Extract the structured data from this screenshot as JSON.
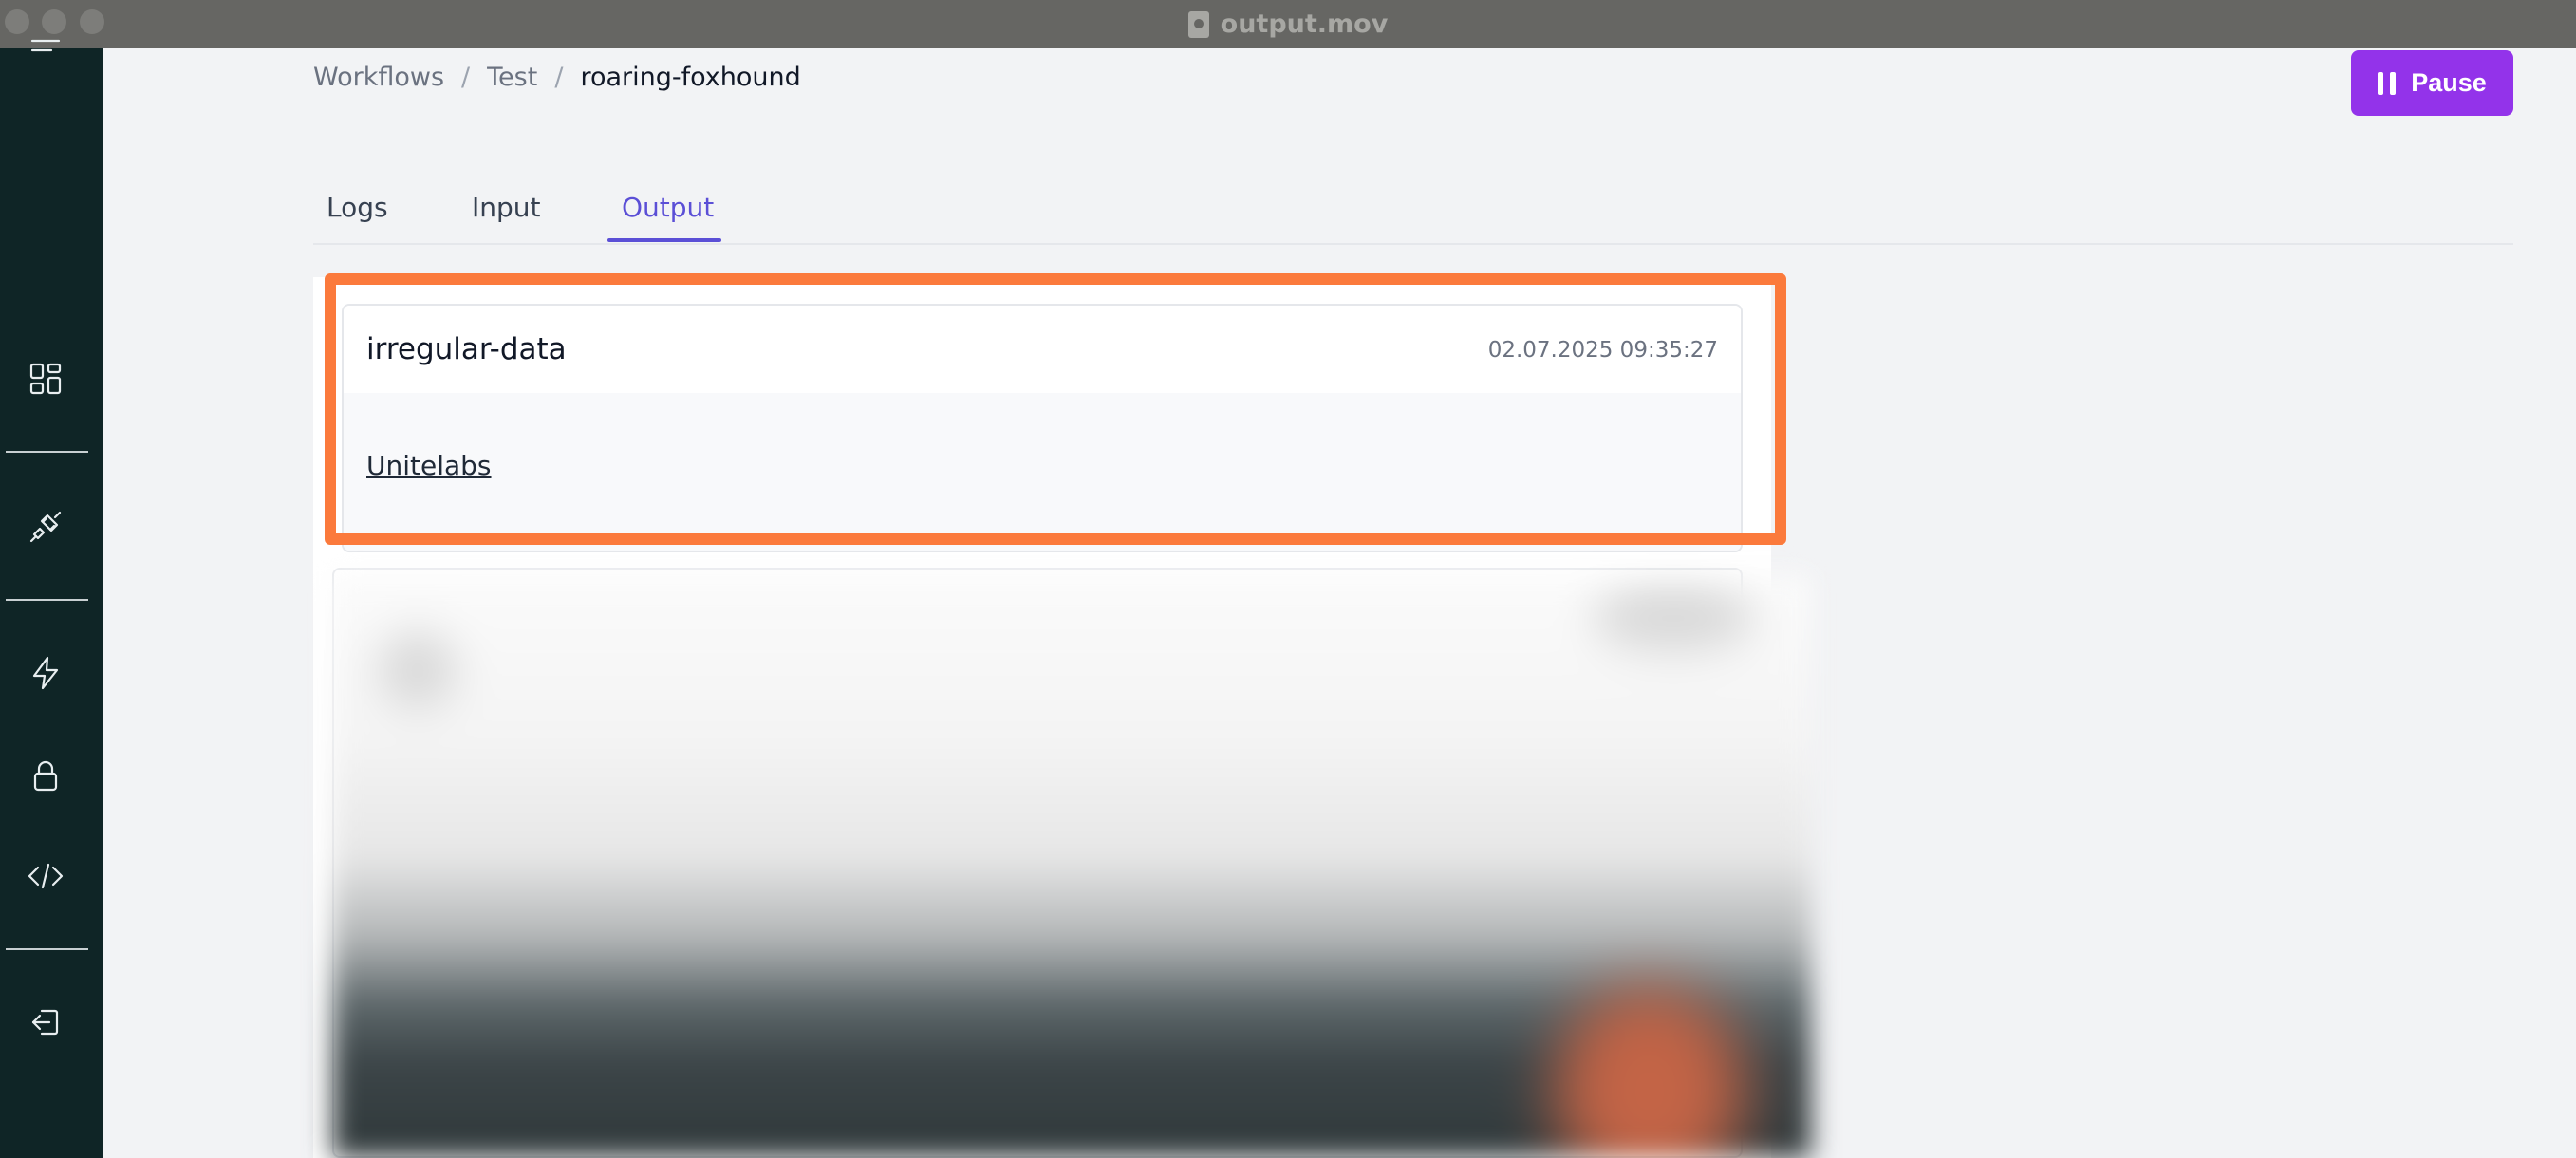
{
  "window": {
    "title": "output.mov"
  },
  "breadcrumb": {
    "items": [
      "Workflows",
      "Test",
      "roaring-foxhound"
    ],
    "separator": "/"
  },
  "header": {
    "pause_label": "Pause"
  },
  "tabs": [
    {
      "label": "Logs",
      "active": false
    },
    {
      "label": "Input",
      "active": false
    },
    {
      "label": "Output",
      "active": true
    }
  ],
  "output": {
    "title": "irregular-data",
    "timestamp": "02.07.2025 09:35:27",
    "link_text": "Unitelabs"
  },
  "colors": {
    "accent": "#5b4fd6",
    "pause_button": "#9333ea",
    "highlight": "#fb7a3c",
    "sidebar": "#0f2526"
  },
  "sidebar_icons": [
    "menu-icon",
    "grid-icon",
    "plug-icon",
    "lightning-icon",
    "lock-icon",
    "code-icon",
    "logout-icon"
  ]
}
